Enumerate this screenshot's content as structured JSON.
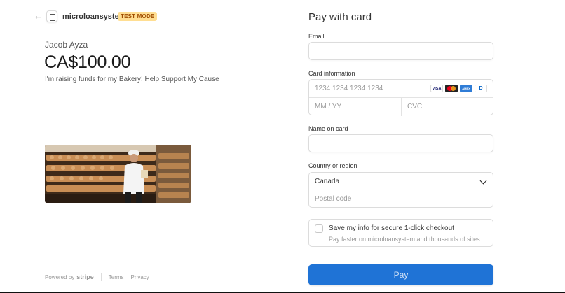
{
  "header": {
    "back_icon": "arrow-left-icon",
    "logo_icon": "store-logo-icon",
    "brand": "microloansystem",
    "mode_badge": "TEST MODE"
  },
  "summary": {
    "payee": "Jacob Ayza",
    "amount": "CA$100.00",
    "description": "I'm raising funds for my Bakery! Help Support My Cause"
  },
  "footer": {
    "powered_by": "Powered by",
    "stripe": "stripe",
    "terms": "Terms",
    "privacy": "Privacy"
  },
  "form": {
    "title": "Pay with card",
    "email_label": "Email",
    "email_value": "",
    "card_label": "Card information",
    "card_number_placeholder": "1234 1234 1234 1234",
    "card_brands": [
      "VISA",
      "mastercard",
      "AMEX",
      "Diners"
    ],
    "expiry_placeholder": "MM / YY",
    "cvc_placeholder": "CVC",
    "name_label": "Name on card",
    "name_value": "",
    "country_label": "Country or region",
    "country_value": "Canada",
    "postal_placeholder": "Postal code",
    "save_label": "Save my info for secure 1-click checkout",
    "save_sub": "Pay faster on microloansystem and thousands of sites.",
    "pay_label": "Pay"
  },
  "colors": {
    "pay_button": "#1f73d6",
    "badge_bg": "#ffde92",
    "badge_text": "#a04c00"
  }
}
